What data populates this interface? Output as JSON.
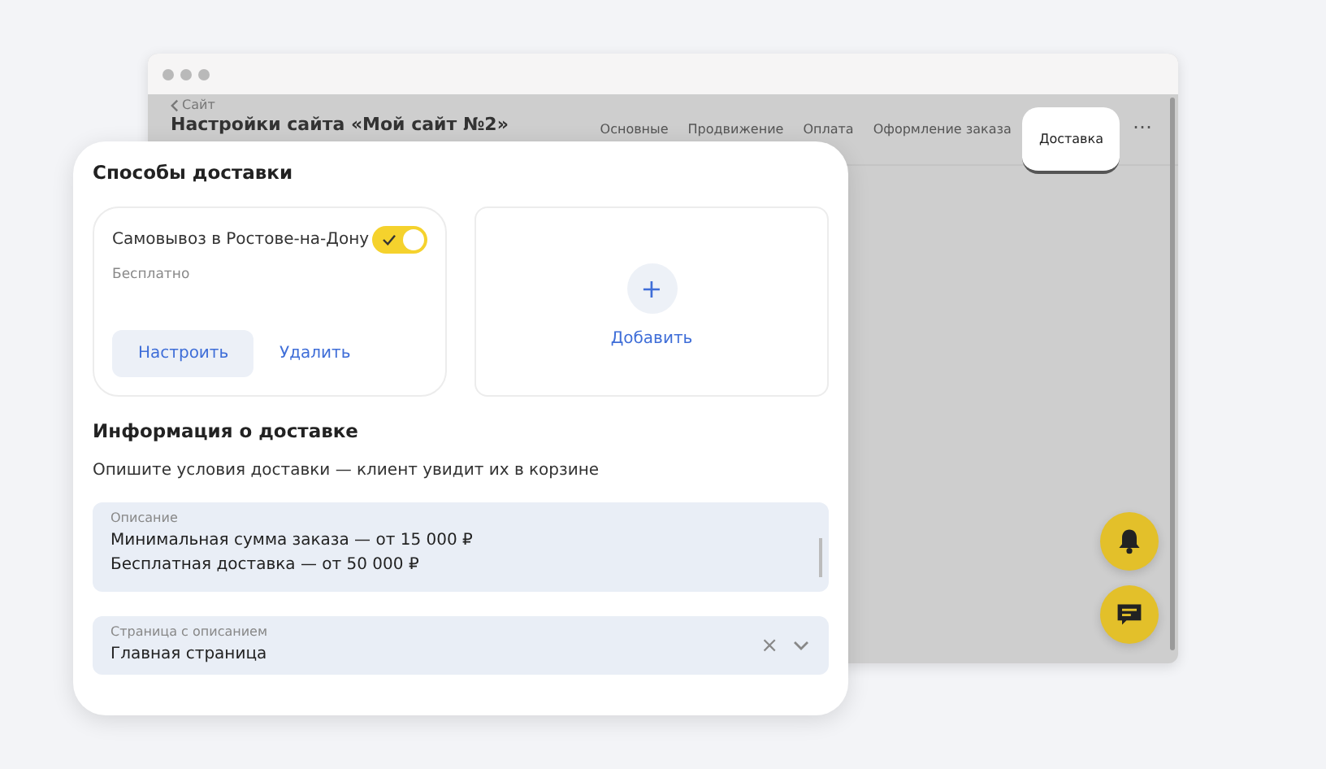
{
  "window": {
    "back_link": "Сайт",
    "title": "Настройки сайта «Мой сайт №2»",
    "tabs": [
      {
        "label": "Основные",
        "selected": false
      },
      {
        "label": "Продвижение",
        "selected": false
      },
      {
        "label": "Оплата",
        "selected": false
      },
      {
        "label": "Оформление заказа",
        "selected": false
      },
      {
        "label": "Доставка",
        "selected": true
      }
    ],
    "more": "⋯"
  },
  "panel": {
    "title": "Способы доставки",
    "methods": [
      {
        "name": "Самовывоз в Ростове-на-Дону",
        "on": true,
        "price": "Бесплатно",
        "configure": "Настроить",
        "delete": "Удалить"
      }
    ],
    "add": {
      "icon": "+",
      "label": "Добавить"
    },
    "info_title": "Информация о доставке",
    "info_text": "Опишите условия доставки — клиент увидит их в корзине",
    "description": {
      "label": "Описание",
      "lines": [
        "Минимальная сумма заказа — от 15 000 ₽",
        "Бесплатная доставка — от 50 000 ₽"
      ]
    },
    "page_select": {
      "label": "Страница с описанием",
      "value": "Главная страница",
      "clear": "×"
    }
  }
}
